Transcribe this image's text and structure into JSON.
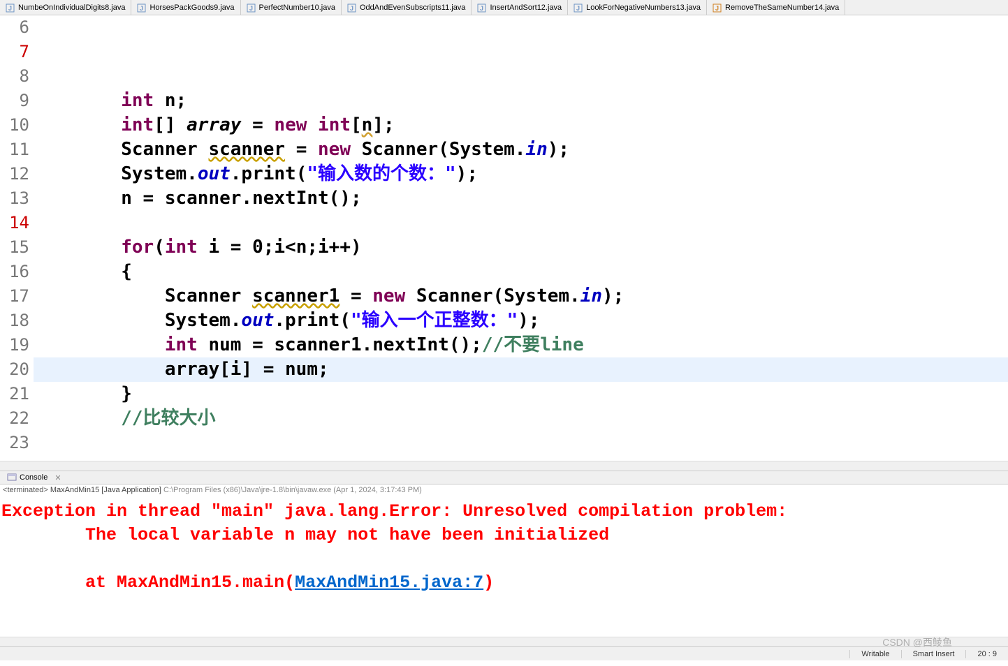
{
  "tabs": [
    {
      "label": "NumbeOnIndividualDigits8.java",
      "icon": "J"
    },
    {
      "label": "HorsesPackGoods9.java",
      "icon": "J"
    },
    {
      "label": "PerfectNumber10.java",
      "icon": "J"
    },
    {
      "label": "OddAndEvenSubscripts11.java",
      "icon": "J"
    },
    {
      "label": "InsertAndSort12.java",
      "icon": "J"
    },
    {
      "label": "LookForNegativeNumbers13.java",
      "icon": "J"
    },
    {
      "label": "RemoveTheSameNumber14.java",
      "icon": "J"
    }
  ],
  "editor": {
    "lineStart": 6,
    "lineEnd": 23,
    "highlightLine": 20,
    "errorLines": [
      7,
      14
    ],
    "code": {
      "l6": {
        "indent": "        ",
        "kw1": "int",
        "rest": " n;"
      },
      "l7": {
        "indent": "        ",
        "kw1": "int",
        "p1": "[] ",
        "var1": "array",
        "p2": " = ",
        "kw2": "new",
        "p3": " ",
        "kw3": "int",
        "p4": "[",
        "warn": "n",
        "p5": "];"
      },
      "l8": {
        "indent": "        ",
        "t1": "Scanner ",
        "und": "scanner",
        "t2": " = ",
        "kw": "new",
        "t3": " Scanner(System.",
        "it": "in",
        "t4": ");"
      },
      "l9": {
        "indent": "        ",
        "t1": "System.",
        "it": "out",
        "t2": ".print(",
        "str": "\"输入数的个数：\"",
        "t3": ");"
      },
      "l10": {
        "indent": "        ",
        "t1": "n = scanner.nextInt();"
      },
      "l12": {
        "indent": "        ",
        "kw": "for",
        "t1": "(",
        "kw2": "int",
        "t2": " i = 0;i<n;i++)"
      },
      "l13": {
        "indent": "        ",
        "t": "{"
      },
      "l14": {
        "indent": "            ",
        "t1": "Scanner ",
        "und": "scanner1",
        "t2": " = ",
        "kw": "new",
        "t3": " Scanner(System.",
        "it": "in",
        "t4": ");"
      },
      "l15": {
        "indent": "            ",
        "t1": "System.",
        "it": "out",
        "t2": ".print(",
        "str": "\"输入一个正整数：\"",
        "t3": ");"
      },
      "l16": {
        "indent": "            ",
        "kw": "int",
        "t1": " num = scanner1.nextInt();",
        "cmt": "//不要line"
      },
      "l17": {
        "indent": "            ",
        "t": "array[i] = num;"
      },
      "l18": {
        "indent": "        ",
        "t": "}"
      },
      "l19": {
        "indent": "        ",
        "cmt": "//比较大小"
      },
      "l22": {
        "indent": "    ",
        "t": "}"
      },
      "l23": {
        "indent": "",
        "t": "}"
      }
    }
  },
  "console": {
    "tab": "Console",
    "header": {
      "status": "terminated>",
      "app": "MaxAndMin15 [Java Application]",
      "path": "C:\\Program Files (x86)\\Java\\jre-1.8\\bin\\javaw.exe (Apr 1, 2024, 3:17:43 PM)"
    },
    "out": {
      "line1": "Exception in thread \"main\" java.lang.Error: Unresolved compilation problem:",
      "line2": "        The local variable n may not have been initialized",
      "line3_a": "        at MaxAndMin15.main(",
      "line3_link": "MaxAndMin15.java:7",
      "line3_b": ")"
    }
  },
  "status": {
    "writable": "Writable",
    "insert": "Smart Insert",
    "pos": "20 : 9"
  },
  "watermark": "CSDN @西鲮鱼"
}
